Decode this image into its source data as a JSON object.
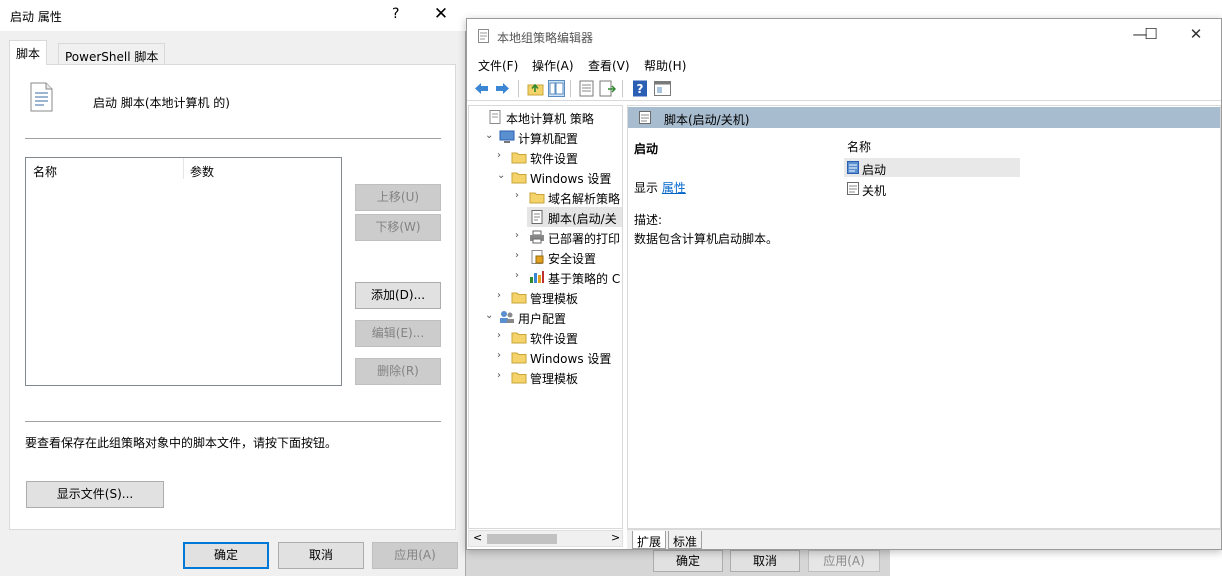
{
  "background_dialog": {
    "ok_label": "确定",
    "cancel_label": "取消",
    "apply_label": "应用(A)"
  },
  "dialog": {
    "title": "启动 属性",
    "help_glyph": "?",
    "close_glyph": "✕",
    "tabs": [
      {
        "label": "脚本",
        "active": true
      },
      {
        "label": "PowerShell 脚本",
        "active": false
      }
    ],
    "heading": "启动 脚本(本地计算机 的)",
    "list_columns": [
      "名称",
      "参数"
    ],
    "buttons": {
      "move_up": "上移(U)",
      "move_down": "下移(W)",
      "add": "添加(D)...",
      "edit": "编辑(E)...",
      "remove": "删除(R)"
    },
    "help_text": "要查看保存在此组策略对象中的脚本文件，请按下面按钮。",
    "show_files": "显示文件(S)...",
    "ok": "确定",
    "cancel": "取消",
    "apply": "应用(A)"
  },
  "editor": {
    "title": "本地组策略编辑器",
    "window_controls": [
      "—",
      "☐",
      "✕"
    ],
    "menu": [
      "文件(F)",
      "操作(A)",
      "查看(V)",
      "帮助(H)"
    ],
    "toolbar_icons": [
      "back-arrow-icon",
      "forward-arrow-icon",
      "up-folder-icon",
      "show-hide-tree-icon",
      "properties-icon",
      "export-list-icon",
      "help-icon",
      "view-icon"
    ],
    "tree": [
      {
        "label": "本地计算机 策略",
        "icon": "policy-doc-icon",
        "chevron": ""
      },
      {
        "label": "计算机配置",
        "icon": "computer-icon",
        "chevron": "⌄"
      },
      {
        "label": "软件设置",
        "icon": "folder-icon",
        "chevron": "›"
      },
      {
        "label": "Windows 设置",
        "icon": "folder-icon",
        "chevron": "⌄"
      },
      {
        "label": "域名解析策略",
        "icon": "folder-icon",
        "chevron": "›"
      },
      {
        "label": "脚本(启动/关",
        "icon": "script-icon",
        "chevron": "",
        "selected": true
      },
      {
        "label": "已部署的打印",
        "icon": "printer-icon",
        "chevron": "›"
      },
      {
        "label": "安全设置",
        "icon": "security-icon",
        "chevron": "›"
      },
      {
        "label": "基于策略的 C",
        "icon": "chart-icon",
        "chevron": "›"
      },
      {
        "label": "管理模板",
        "icon": "folder-icon",
        "chevron": "›"
      },
      {
        "label": "用户配置",
        "icon": "users-icon",
        "chevron": "⌄"
      },
      {
        "label": "软件设置",
        "icon": "folder-icon",
        "chevron": "›"
      },
      {
        "label": "Windows 设置",
        "icon": "folder-icon",
        "chevron": "›"
      },
      {
        "label": "管理模板",
        "icon": "folder-icon",
        "chevron": "›"
      }
    ],
    "scroll_left": "<",
    "scroll_right": ">",
    "content_header": "脚本(启动/关机)",
    "detail_title": "启动",
    "detail_show_prefix": "显示",
    "detail_show_link": "属性",
    "detail_desc_label": "描述:",
    "detail_desc": "数据包含计算机启动脚本。",
    "list_column": "名称",
    "list_items": [
      {
        "label": "启动",
        "hover": true
      },
      {
        "label": "关机",
        "hover": false
      }
    ],
    "bottom_tabs": [
      {
        "label": "扩展",
        "active": true
      },
      {
        "label": "标准",
        "active": false
      }
    ]
  },
  "colors": {
    "accent": "#0078d7",
    "content_header_bg": "#a8bccf",
    "link": "#0066cc",
    "folder": "#f4d36b"
  }
}
